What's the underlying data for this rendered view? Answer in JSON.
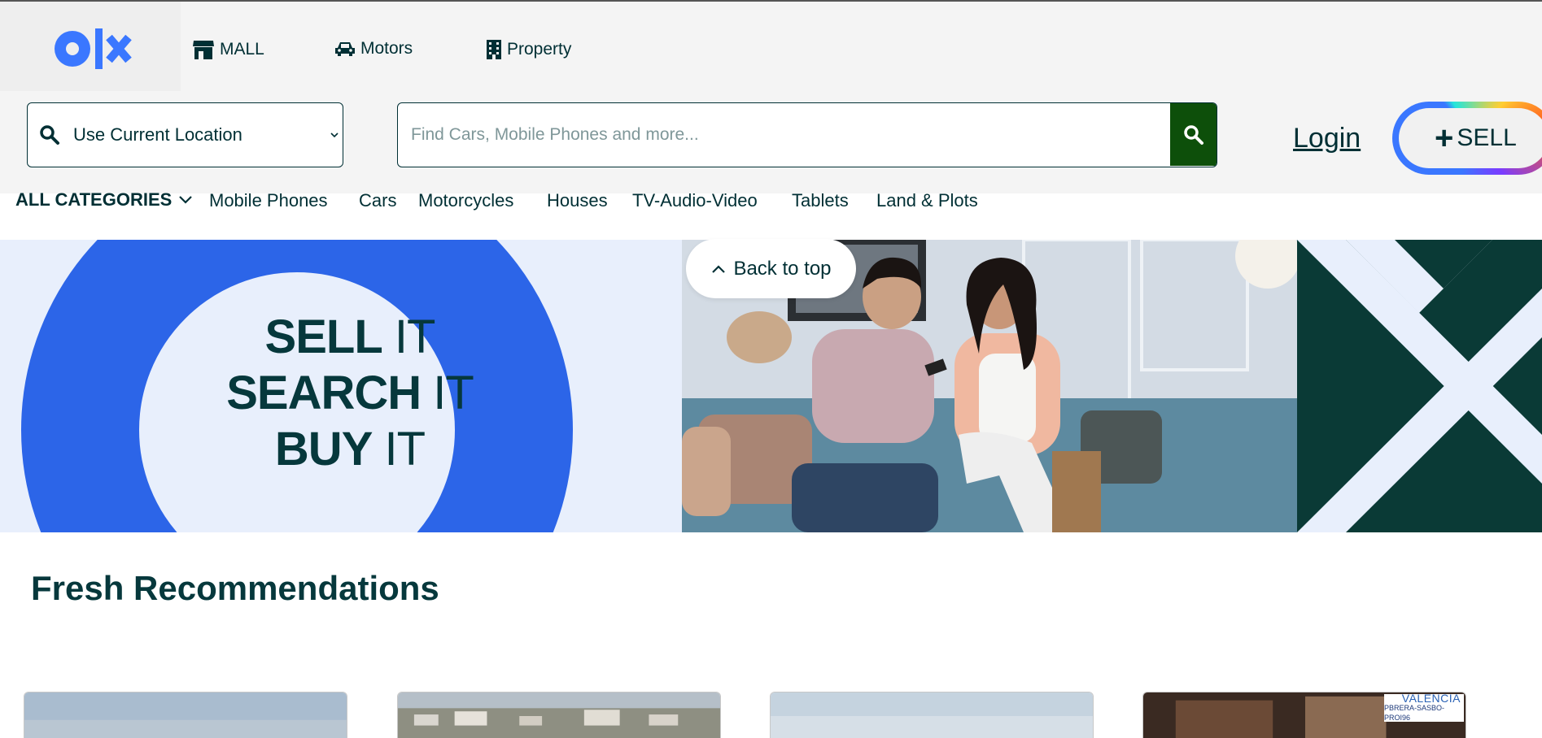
{
  "header": {
    "logo_icon": "olx-logo",
    "nav": [
      {
        "label": "MALL",
        "icon": "store-icon"
      },
      {
        "label": "Motors",
        "icon": "car-icon"
      },
      {
        "label": "Property",
        "icon": "building-icon"
      }
    ],
    "location": {
      "value": "Use Current Location"
    },
    "search": {
      "placeholder": "Find Cars, Mobile Phones and more..."
    },
    "login_label": "Login",
    "sell_label": "SELL"
  },
  "categories": {
    "all_label": "ALL CATEGORIES",
    "items": [
      "Mobile Phones",
      "Cars",
      "Motorcycles",
      "Houses",
      "TV-Audio-Video",
      "Tablets",
      "Land & Plots"
    ]
  },
  "banner": {
    "line1_bold": "SELL",
    "line1_rest": " IT",
    "line2_bold": "SEARCH",
    "line2_rest": " IT",
    "line3_bold": "BUY",
    "line3_rest": " IT"
  },
  "back_to_top_label": "Back to top",
  "recommendations": {
    "title": "Fresh Recommendations",
    "card4_badge_line1": "VALENCIA",
    "card4_badge_line2": "PBRERA-SASBO-PROI96"
  },
  "colors": {
    "brand_blue": "#3a77ff",
    "dark_teal": "#002f34",
    "search_button_green": "#0d4f0a"
  }
}
